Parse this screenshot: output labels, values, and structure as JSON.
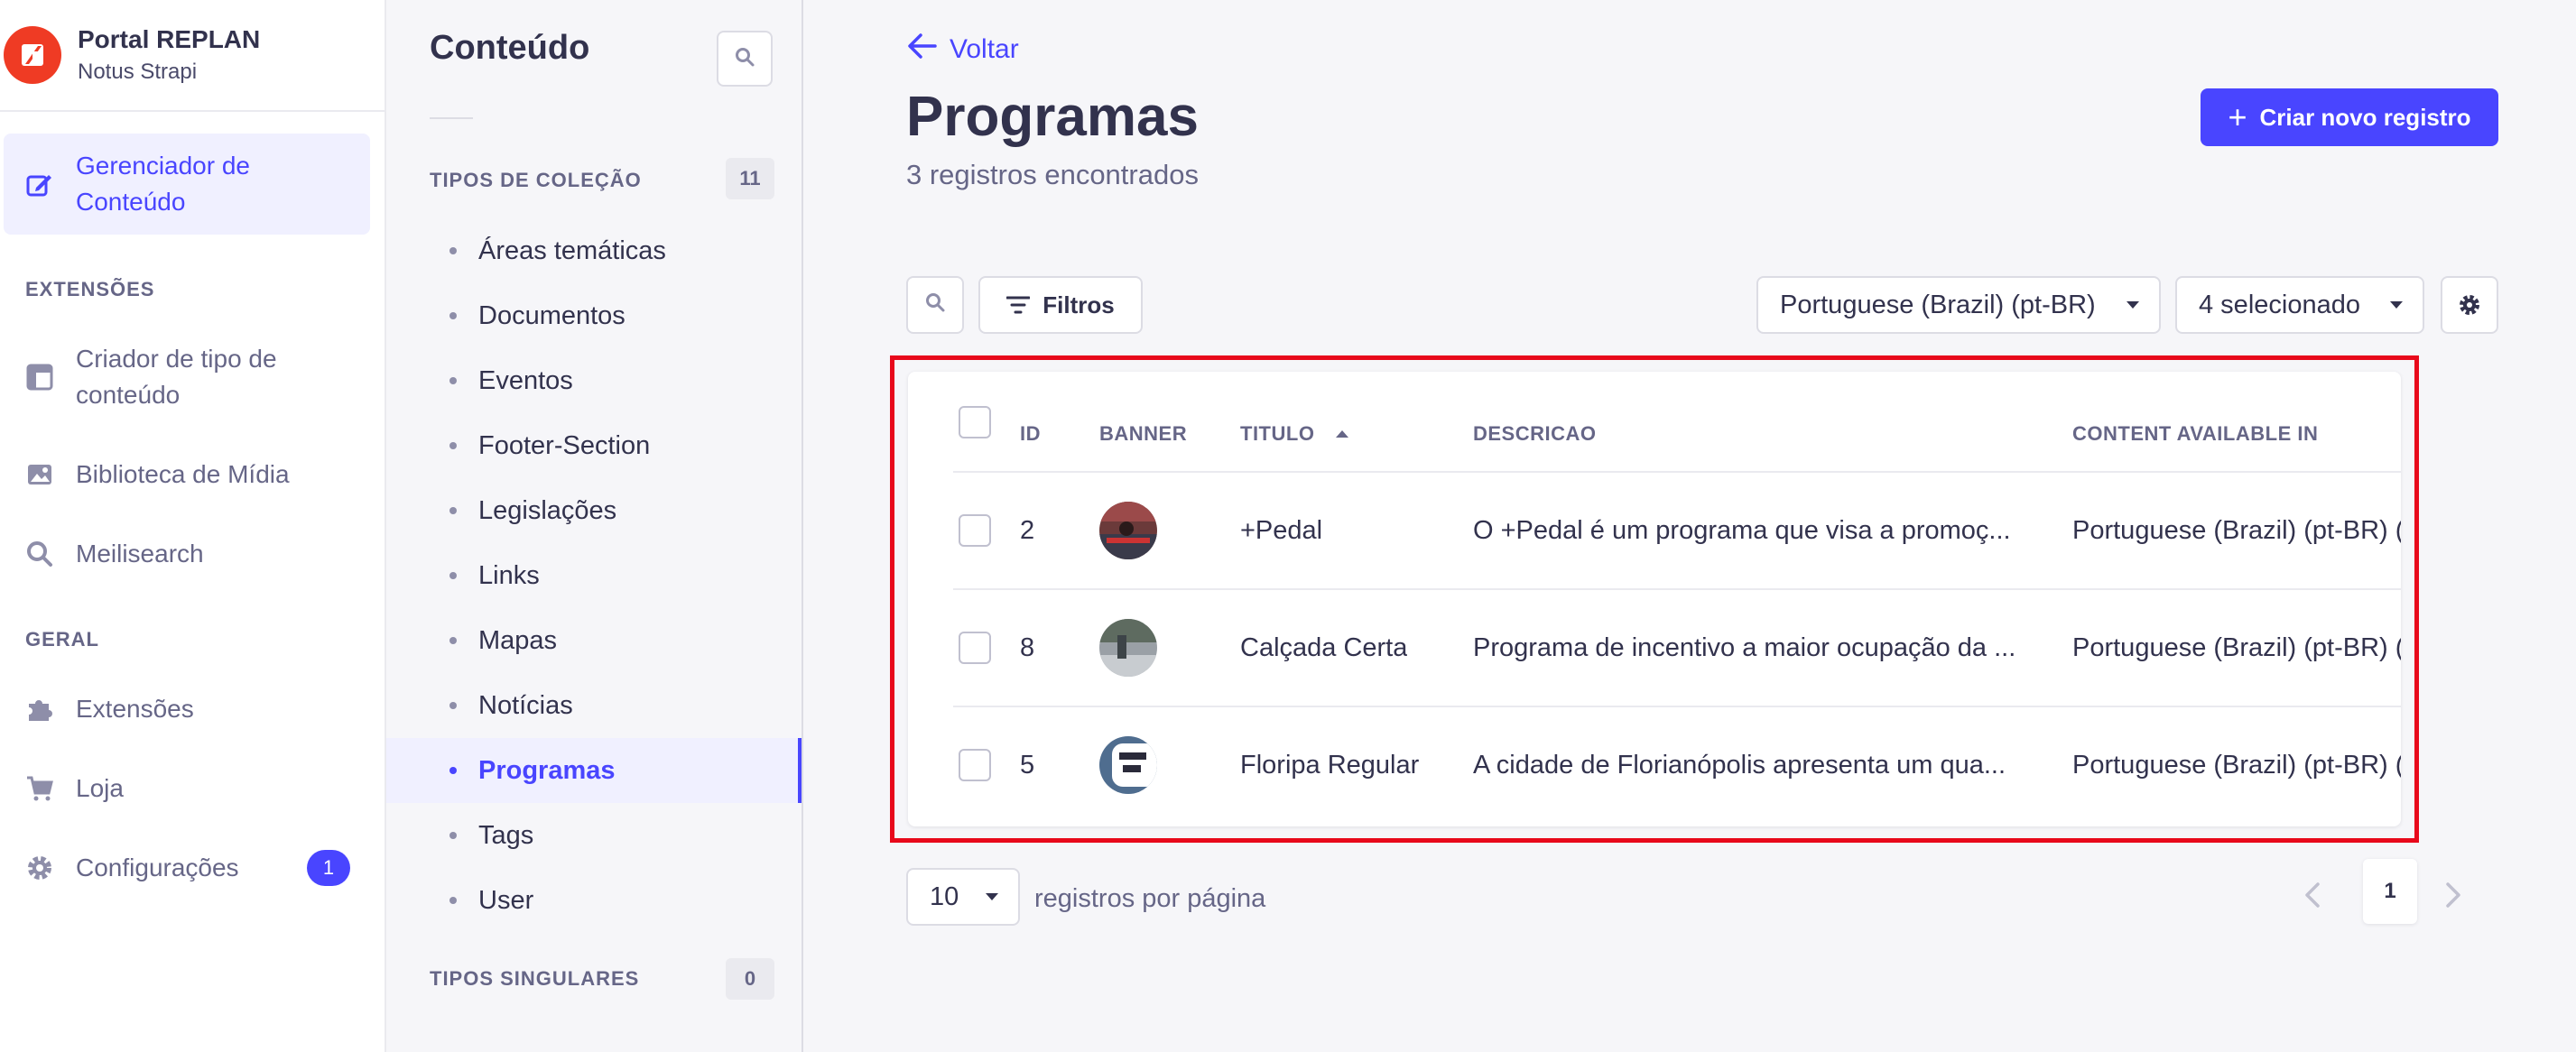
{
  "brand": {
    "title": "Portal REPLAN",
    "subtitle": "Notus Strapi",
    "color": "#ef3b24"
  },
  "leftnav": {
    "items": [
      {
        "label": "Gerenciador de Conteúdo",
        "icon": "pencil-icon",
        "active": true
      },
      {
        "label": "Criador de tipo de conteúdo",
        "icon": "layout-icon"
      },
      {
        "label": "Biblioteca de Mídia",
        "icon": "image-icon"
      },
      {
        "label": "Meilisearch",
        "icon": "search-icon"
      },
      {
        "label": "Extensões",
        "icon": "puzzle-icon"
      },
      {
        "label": "Loja",
        "icon": "cart-icon"
      },
      {
        "label": "Configurações",
        "icon": "gear-icon",
        "badge": "1"
      }
    ],
    "sections": {
      "extensoes": "EXTENSÕES",
      "geral": "GERAL"
    }
  },
  "subnav": {
    "title": "Conteúdo",
    "collection_title": "TIPOS DE COLEÇÃO",
    "collection_count": "11",
    "items": [
      {
        "label": "Áreas temáticas"
      },
      {
        "label": "Documentos"
      },
      {
        "label": "Eventos"
      },
      {
        "label": "Footer-Section"
      },
      {
        "label": "Legislações"
      },
      {
        "label": "Links"
      },
      {
        "label": "Mapas"
      },
      {
        "label": "Notícias"
      },
      {
        "label": "Programas",
        "active": true
      },
      {
        "label": "Tags"
      },
      {
        "label": "User"
      }
    ],
    "single_title": "TIPOS SINGULARES",
    "single_count": "0"
  },
  "main": {
    "back_label": "Voltar",
    "title": "Programas",
    "subtitle": "3 registros encontrados",
    "create_label": "Criar novo registro",
    "filters_label": "Filtros",
    "locale_value": "Portuguese (Brazil) (pt-BR)",
    "columns_value": "4 selecionado",
    "accent": "#4945ff"
  },
  "table": {
    "headers": {
      "id": "ID",
      "banner": "BANNER",
      "titulo": "TITULO",
      "descricao": "DESCRICAO",
      "available": "CONTENT AVAILABLE IN"
    },
    "rows": [
      {
        "id": "2",
        "titulo": "+Pedal",
        "descricao": "O +Pedal é um programa que visa a promoç...",
        "available": "Portuguese (Brazil) (pt-BR) (default)"
      },
      {
        "id": "8",
        "titulo": "Calçada Certa",
        "descricao": "Programa de incentivo a maior ocupação da ...",
        "available": "Portuguese (Brazil) (pt-BR) (default)"
      },
      {
        "id": "5",
        "titulo": "Floripa Regular",
        "descricao": "A cidade de Florianópolis apresenta um qua...",
        "available": "Portuguese (Brazil) (pt-BR) (default)"
      }
    ]
  },
  "pagination": {
    "page_size": "10",
    "page_size_label": "registros por página",
    "current_page": "1"
  }
}
